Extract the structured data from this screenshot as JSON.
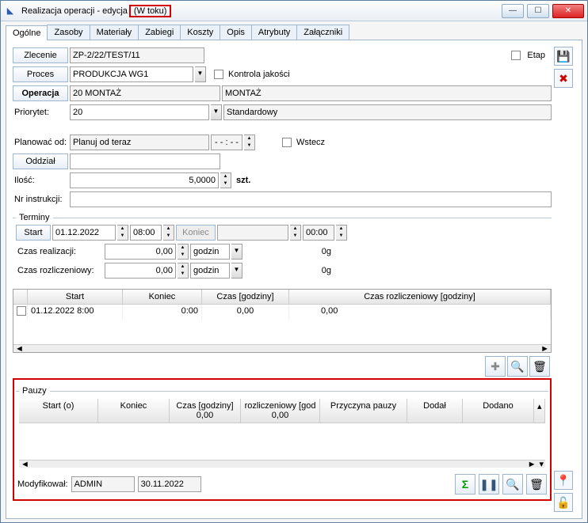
{
  "titlebar": {
    "title": "Realizacja operacji - edycja",
    "status": "(W toku)"
  },
  "tabs": [
    "Ogólne",
    "Zasoby",
    "Materiały",
    "Zabiegi",
    "Koszty",
    "Opis",
    "Atrybuty",
    "Załączniki"
  ],
  "active_tab": 0,
  "form": {
    "zlecenie_label": "Zlecenie",
    "zlecenie_value": "ZP-2/22/TEST/11",
    "etap_label": "Etap",
    "proces_label": "Proces",
    "proces_value": "PRODUKCJA WG1",
    "kontrola_label": "Kontrola jakości",
    "operacja_label": "Operacja",
    "operacja_code": "20 MONTAŻ",
    "operacja_name": "MONTAŻ",
    "priorytet_label": "Priorytet:",
    "priorytet_value": "20",
    "priorytet_std": "Standardowy",
    "planowac_label": "Planować od:",
    "planowac_value": "Planuj od teraz",
    "time_blank": "- - : - -",
    "wstecz_label": "Wstecz",
    "oddzial_label": "Oddział",
    "ilosc_label": "Ilość:",
    "ilosc_value": "5,0000",
    "ilosc_unit": "szt.",
    "nrinstr_label": "Nr instrukcji:"
  },
  "terminy": {
    "legend": "Terminy",
    "start_label": "Start",
    "start_date": "01.12.2022",
    "start_time": "08:00",
    "koniec_label": "Koniec",
    "koniec_date": "",
    "koniec_time": "00:00",
    "czasreal_label": "Czas realizacji:",
    "czasreal_value": "0,00",
    "czasreal_unit": "godzin",
    "czasreal_sum": "0g",
    "czasrozl_label": "Czas rozliczeniowy:",
    "czasrozl_value": "0,00",
    "czasrozl_unit": "godzin",
    "czasrozl_sum": "0g"
  },
  "grid1": {
    "cols": [
      "",
      "Start",
      "Koniec",
      "Czas [godziny]",
      "Czas rozliczeniowy [godziny]"
    ],
    "row": [
      "",
      "01.12.2022   8:00",
      "0:00",
      "0,00",
      "0,00"
    ]
  },
  "pauzy": {
    "legend": "Pauzy",
    "cols": [
      "Start (o)",
      "Koniec",
      "Czas [godziny]",
      "rozliczeniowy [god",
      "Przyczyna pauzy",
      "Dodał",
      "Dodano"
    ],
    "sub": [
      "",
      "",
      "0,00",
      "0,00",
      "",
      "",
      ""
    ]
  },
  "footer": {
    "mod_label": "Modyfikował:",
    "mod_user": "ADMIN",
    "mod_date": "30.11.2022"
  },
  "icons": {
    "save": "💾",
    "delete": "✖",
    "plus": "✚",
    "search": "🔍",
    "trash": "🗑",
    "sigma": "Σ",
    "pause": "❚❚",
    "lock": "🔓",
    "pin": "📍"
  }
}
